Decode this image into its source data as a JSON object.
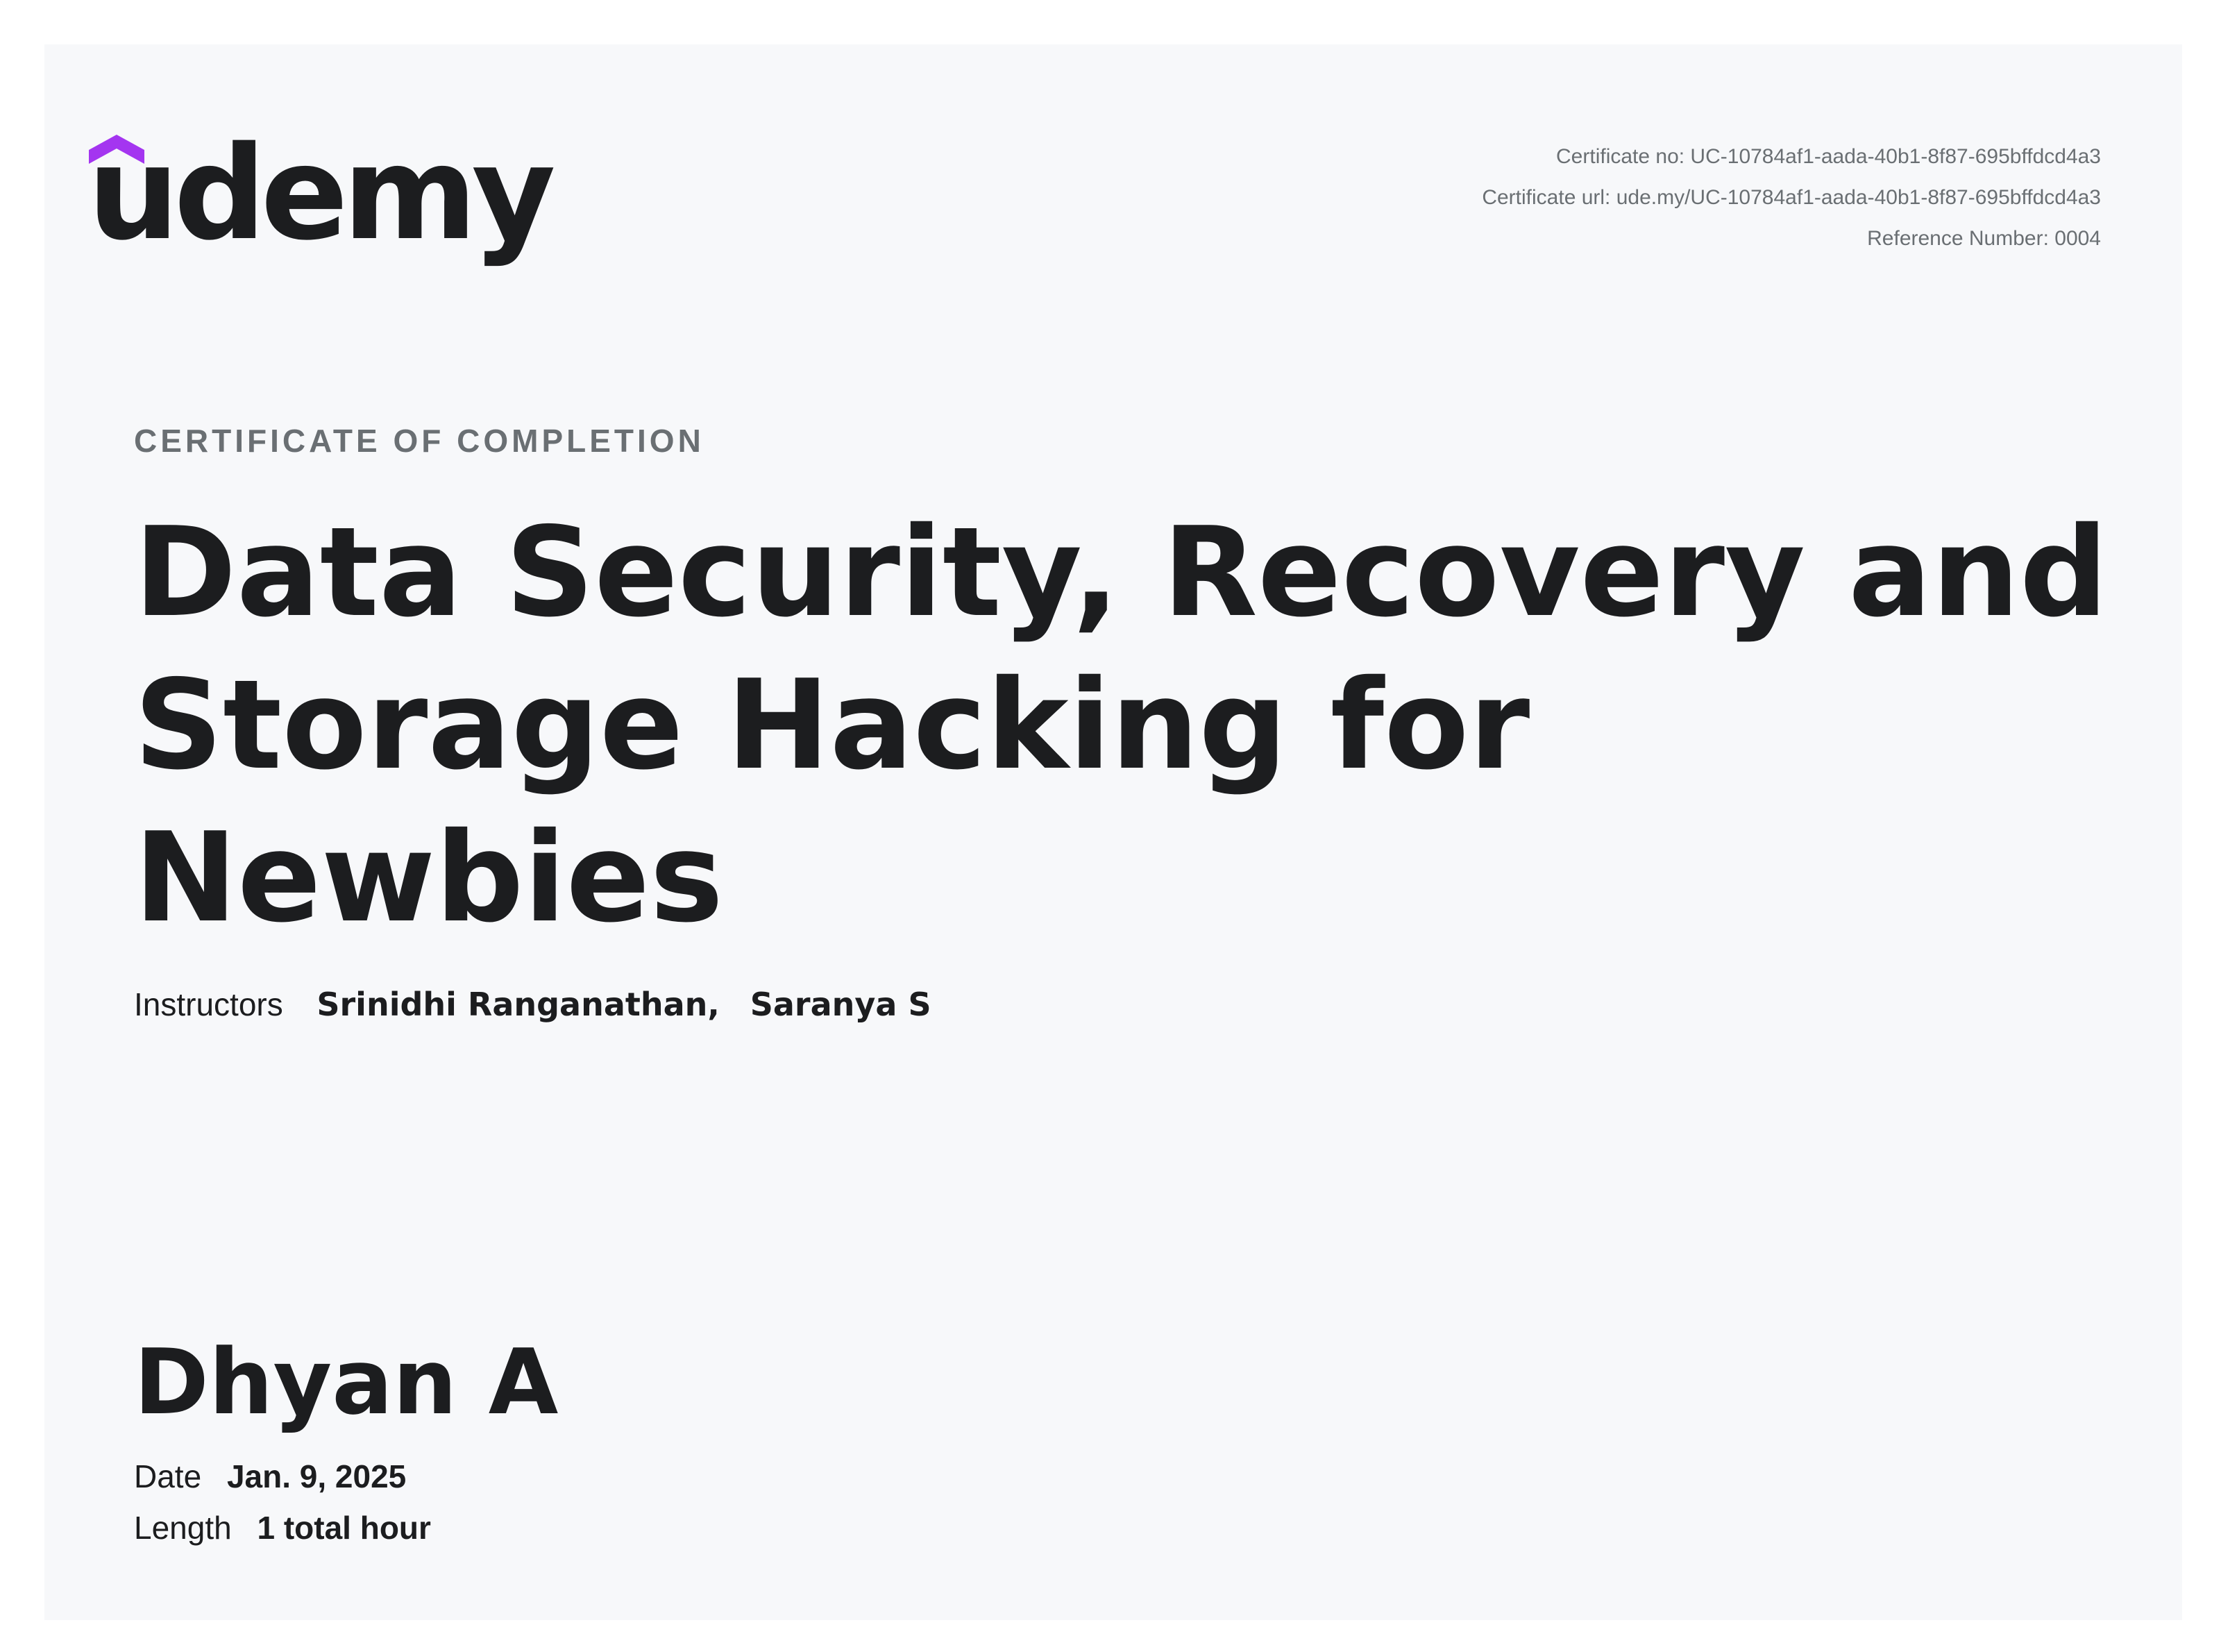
{
  "brand": {
    "logo_text": "udemy",
    "accent_color": "#a435f0",
    "text_color": "#1c1d1f",
    "muted_color": "#6a6f73",
    "background_color": "#f7f8fa"
  },
  "meta": {
    "certificate_no": "Certificate no: UC-10784af1-aada-40b1-8f87-695bffdcd4a3",
    "certificate_url": "Certificate url: ude.my/UC-10784af1-aada-40b1-8f87-695bffdcd4a3",
    "reference_number": "Reference Number: 0004"
  },
  "certificate": {
    "heading": "CERTIFICATE OF COMPLETION",
    "course_title": "Data Security, Recovery and Storage Hacking for Newbies",
    "instructors_label": "Instructors",
    "instructors": [
      "Srinidhi Ranganathan,",
      "Saranya S"
    ],
    "recipient": "Dhyan A",
    "date_label": "Date",
    "date_value": "Jan. 9, 2025",
    "length_label": "Length",
    "length_value": "1 total hour"
  }
}
